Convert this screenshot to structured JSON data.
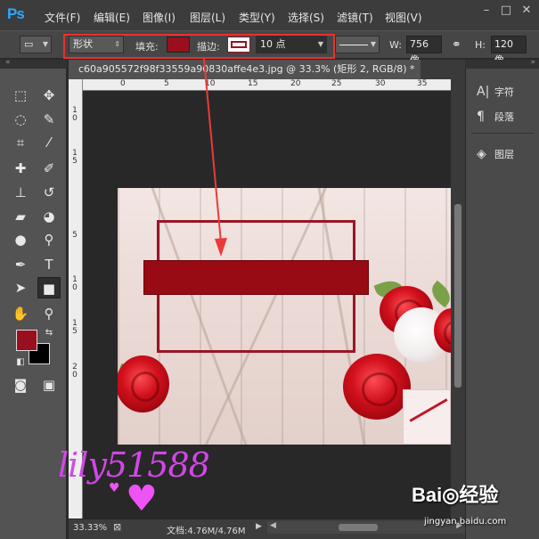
{
  "app": {
    "logo": "Ps"
  },
  "menu": [
    "文件(F)",
    "编辑(E)",
    "图像(I)",
    "图层(L)",
    "类型(Y)",
    "选择(S)",
    "滤镜(T)",
    "视图(V)"
  ],
  "window_controls": {
    "minimize": "–",
    "restore": "□",
    "close": "✕"
  },
  "options": {
    "mode": "形状",
    "fill_label": "填充:",
    "fill_color": "#9a0f1d",
    "stroke_label": "描边:",
    "stroke_size": "10 点",
    "width_label": "W:",
    "width_value": "756 像",
    "height_label": "H:",
    "height_value": "120 像"
  },
  "document": {
    "tab_title": "c60a905572f98f33559a90830affe4e3.jpg @ 33.3% (矩形 2, RGB/8) *",
    "close_glyph": "×"
  },
  "rulers": {
    "top": [
      "0",
      "5",
      "10",
      "15",
      "20",
      "25",
      "30",
      "35"
    ],
    "left": [
      "1\n0",
      "1\n5",
      "5",
      "1\n0",
      "1\n5",
      "2\n0"
    ]
  },
  "status": {
    "zoom": "33.33%",
    "doc_info": "文档:4.76M/4.76M"
  },
  "right_panel": [
    {
      "icon": "character-icon",
      "glyph": "A|",
      "label": "字符"
    },
    {
      "icon": "paragraph-icon",
      "glyph": "¶",
      "label": "段落"
    },
    {
      "icon": "layers-icon",
      "glyph": "◈",
      "label": "图层"
    }
  ],
  "tools": [
    "rectangular-marquee-icon",
    "move-icon",
    "lasso-icon",
    "quick-selection-icon",
    "crop-icon",
    "eyedropper-icon",
    "healing-brush-icon",
    "brush-icon",
    "clone-stamp-icon",
    "history-brush-icon",
    "eraser-icon",
    "paint-bucket-icon",
    "blur-icon",
    "dodge-icon",
    "pen-icon",
    "type-icon",
    "path-selection-icon",
    "rectangle-icon",
    "hand-icon",
    "zoom-icon"
  ],
  "colors": {
    "foreground": "#9a0f1d",
    "background": "#000000",
    "highlight": "#e8322e"
  },
  "overlay": {
    "watermark": "lily51588",
    "baidu_logo": "Bai◎经验",
    "baidu_sub": "jingyan.baidu.com"
  }
}
